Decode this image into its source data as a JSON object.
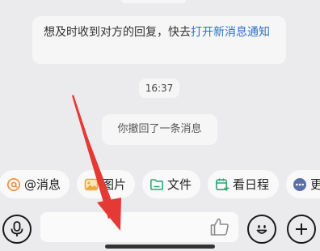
{
  "chat": {
    "notice_text": "想及时收到对方的回复，快去",
    "notice_link": "打开新消息通知",
    "time": "16:37",
    "recall_text": "你撤回了一条消息"
  },
  "quick_actions": [
    {
      "label": "@消息",
      "icon": "at-icon"
    },
    {
      "label": "图片",
      "icon": "image-icon"
    },
    {
      "label": "文件",
      "icon": "folder-icon"
    },
    {
      "label": "看日程",
      "icon": "calendar-icon"
    },
    {
      "label": "更多",
      "icon": "more-icon"
    }
  ],
  "colors": {
    "link": "#2f73c8",
    "mention_icon": "#f08a3c",
    "image_icon": "#e8a93a",
    "file_icon": "#2aa876",
    "calendar_icon": "#2aa876",
    "more_icon": "#5a6ea8",
    "annotation_arrow": "#e53935"
  }
}
